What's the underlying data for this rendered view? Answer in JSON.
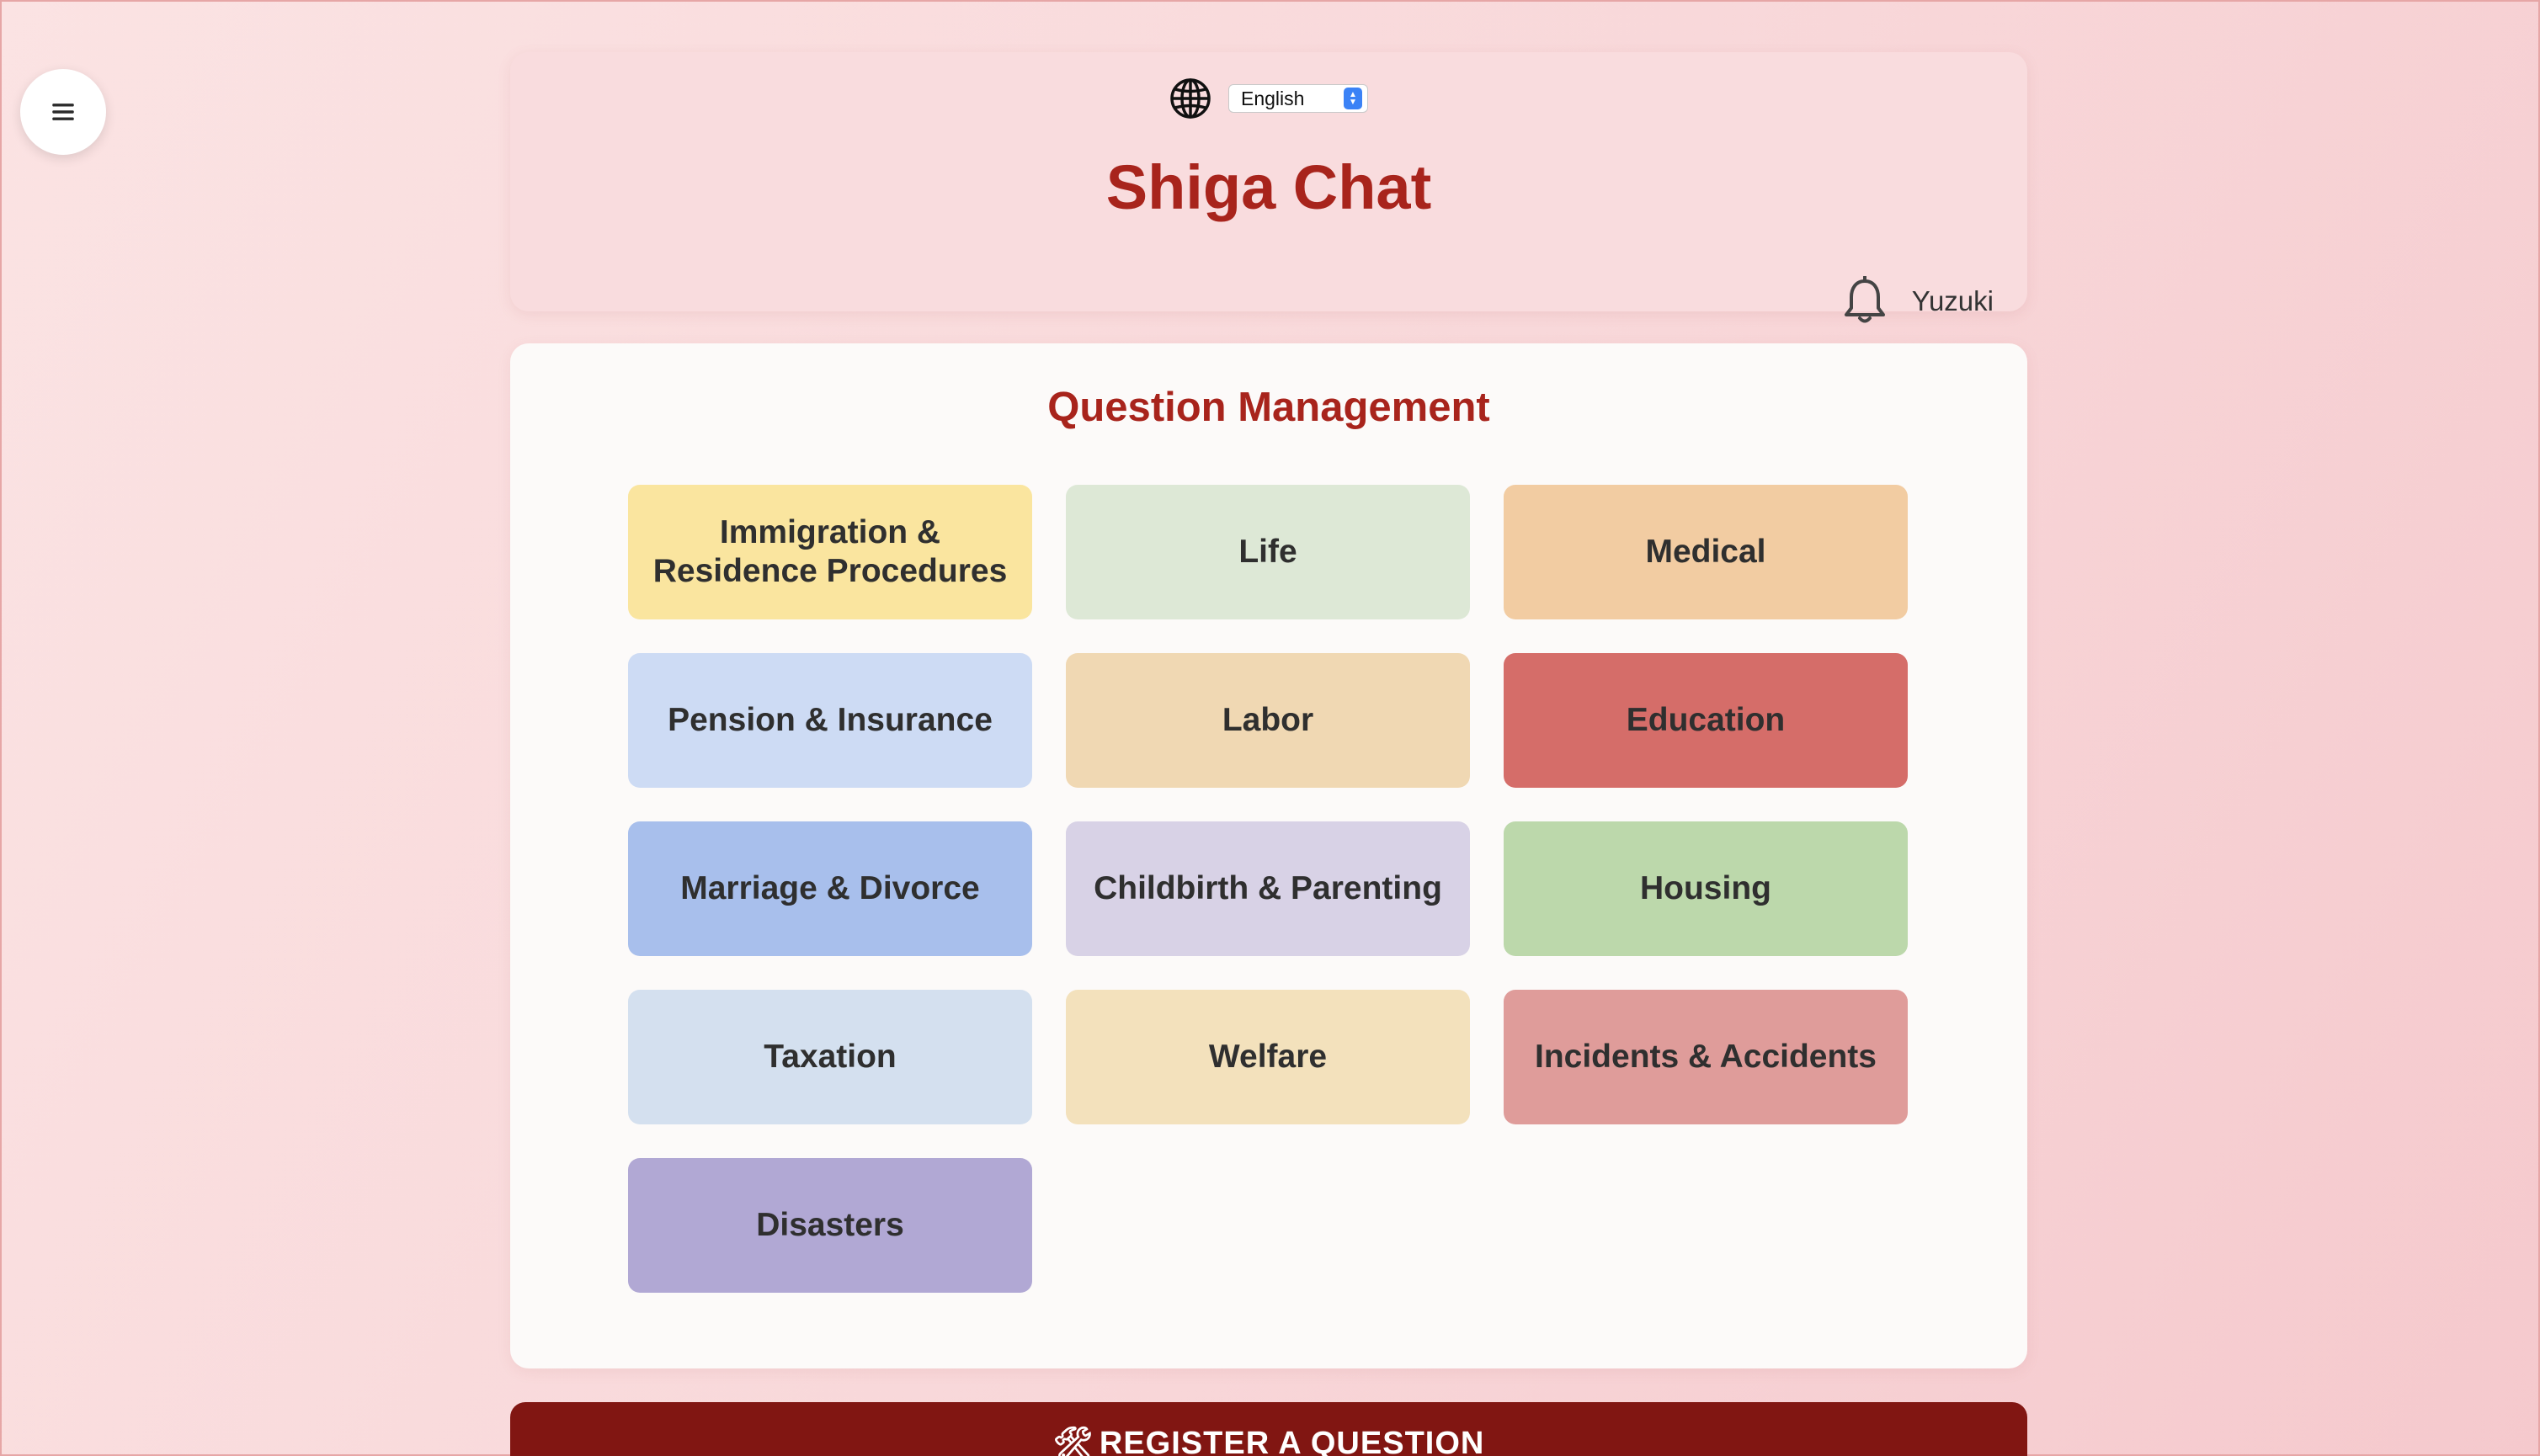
{
  "nav": {
    "menu_icon": "hamburger-menu-icon"
  },
  "header": {
    "language_icon": "globe-icon",
    "language_selected": "English",
    "title": "Shiga Chat",
    "notification_icon": "bell-icon",
    "user_name": "Yuzuki"
  },
  "main": {
    "title": "Question Management",
    "categories": [
      {
        "label": "Immigration & Residence Procedures",
        "color": "#fae59f"
      },
      {
        "label": "Life",
        "color": "#dde8d6"
      },
      {
        "label": "Medical",
        "color": "#f2cca2"
      },
      {
        "label": "Pension & Insurance",
        "color": "#cddbf4"
      },
      {
        "label": "Labor",
        "color": "#f0d8b3"
      },
      {
        "label": "Education",
        "color": "#d56d69"
      },
      {
        "label": "Marriage & Divorce",
        "color": "#a8bfec"
      },
      {
        "label": "Childbirth & Parenting",
        "color": "#d8d2e6"
      },
      {
        "label": "Housing",
        "color": "#bcd8ab"
      },
      {
        "label": "Taxation",
        "color": "#d4e0ef"
      },
      {
        "label": "Welfare",
        "color": "#f3e1bc"
      },
      {
        "label": "Incidents & Accidents",
        "color": "#df9c9a"
      },
      {
        "label": "Disasters",
        "color": "#b1a8d4"
      }
    ]
  },
  "footer": {
    "register_icon": "hammer-and-wrench-icon",
    "register_glyph": "🛠",
    "register_label": "REGISTER A QUESTION"
  },
  "colors": {
    "accent": "#a8241c",
    "register_button": "#811612"
  }
}
